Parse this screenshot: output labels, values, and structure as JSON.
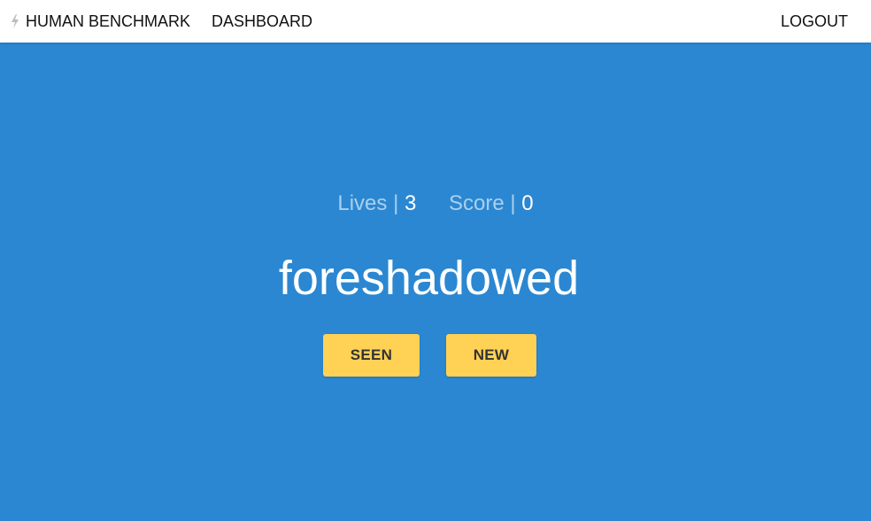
{
  "nav": {
    "brand_label": "HUMAN BENCHMARK",
    "brand_icon": "bolt-icon",
    "dashboard_label": "DASHBOARD",
    "logout_label": "LOGOUT"
  },
  "game": {
    "lives_label": "Lives",
    "separator": "|",
    "lives_value": "3",
    "score_label": "Score",
    "score_value": "0",
    "current_word": "foreshadowed",
    "seen_label": "SEEN",
    "new_label": "NEW"
  },
  "colors": {
    "stage_background": "#2b87d1",
    "button_background": "#ffd154",
    "nav_background": "#ffffff"
  }
}
